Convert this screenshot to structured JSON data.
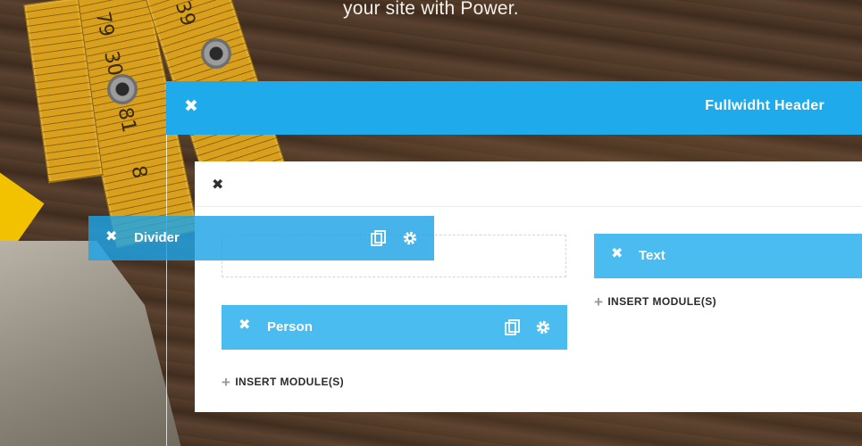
{
  "tagline": "your site with Power.",
  "header": {
    "title": "Fullwidht Header",
    "close_icon": "✖"
  },
  "row": {
    "close_icon": "✖"
  },
  "modules": {
    "text": {
      "label": "Text",
      "close_icon": "✖"
    },
    "person": {
      "label": "Person",
      "close_icon": "✖"
    },
    "divider": {
      "label": "Divider",
      "close_icon": "✖"
    }
  },
  "insert": {
    "plus": "+",
    "label": "INSERT MODULE(S)"
  },
  "background_ruler_numbers": [
    "79",
    "30",
    "81",
    "8",
    "39"
  ],
  "colors": {
    "header_blue": "#1faaec",
    "module_blue": "#4bbcf0",
    "dragging_blue": "#1da4e6",
    "panel": "#ffffff"
  }
}
